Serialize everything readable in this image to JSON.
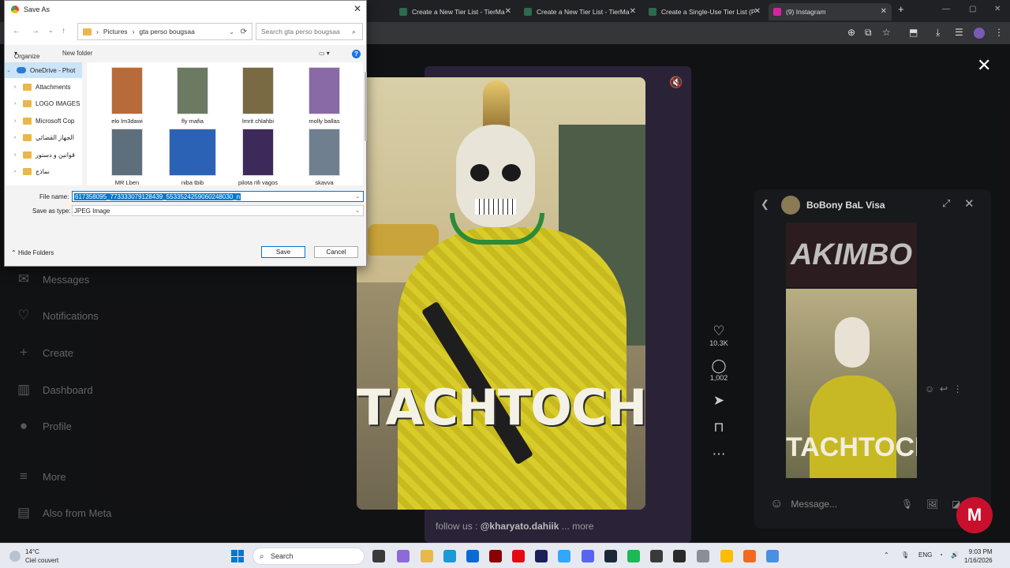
{
  "browser": {
    "tabs": [
      {
        "label": "Create a New Tier List - TierMa",
        "color": "#2d6a4f"
      },
      {
        "label": "Create a New Tier List - TierMa",
        "color": "#2d6a4f"
      },
      {
        "label": "Create a Single-Use Tier List (P",
        "color": "#2d6a4f"
      },
      {
        "label": "(9) Instagram",
        "color": "#d6249f"
      }
    ],
    "new_tab": "+"
  },
  "instagram": {
    "nav": [
      {
        "label": "Messages",
        "icon": "message-icon"
      },
      {
        "label": "Notifications",
        "icon": "heart-icon"
      },
      {
        "label": "Create",
        "icon": "plus-icon"
      },
      {
        "label": "Dashboard",
        "icon": "dashboard-icon"
      },
      {
        "label": "Profile",
        "icon": "avatar-icon"
      },
      {
        "label": "More",
        "icon": "menu-icon"
      },
      {
        "label": "Also from Meta",
        "icon": "meta-icon"
      }
    ],
    "post_title": "TACHTOCH",
    "likes": "10.3K",
    "comments": "1,002",
    "caption_prefix": "follow us :",
    "caption_handle": "@kharyato.dahiik",
    "caption_more": "... more",
    "chat": {
      "name": "BoBony BaL Visa",
      "image_top_text": "AKIMBO",
      "image_text": "TACHTOCH",
      "input_placeholder": "Message..."
    }
  },
  "dialog": {
    "title": "Save As",
    "breadcrumb": [
      "Pictures",
      "gta perso bougsaa"
    ],
    "search_placeholder": "Search gta perso bougsaa",
    "organize": "Organize",
    "new_folder": "New folder",
    "tree": [
      {
        "label": "OneDrive - Phot",
        "selected": true
      },
      {
        "label": "Attachments"
      },
      {
        "label": "LOGO IMAGES"
      },
      {
        "label": "Microsoft Cop"
      },
      {
        "label": "الجهاز القضائي"
      },
      {
        "label": "قوانين و دستور"
      },
      {
        "label": "نماذج"
      }
    ],
    "files": [
      {
        "label": "elo lm3dawi",
        "color": "#b86b3a"
      },
      {
        "label": "fly mafia",
        "color": "#6d7a62"
      },
      {
        "label": "lmrit chlahbi",
        "color": "#7a6a44"
      },
      {
        "label": "molly ballas",
        "color": "#8a6aa6"
      },
      {
        "label": "MR Lben",
        "color": "#5d6f7c"
      },
      {
        "label": "niba tbib",
        "color": "#2c62b5"
      },
      {
        "label": "pilota rifi vagos",
        "color": "#3d2a5a"
      },
      {
        "label": "skavva",
        "color": "#6f7f8f"
      }
    ],
    "file_name_label": "File name:",
    "file_name_value": "617358095_773333079128439_5533524259060248030_n",
    "save_type_label": "Save as type:",
    "save_type_value": "JPEG Image",
    "hide_folders": "Hide Folders",
    "save_button": "Save",
    "cancel_button": "Cancel"
  },
  "taskbar": {
    "temperature": "14°C",
    "weather": "Ciel couvert",
    "search": "Search",
    "lang": "ENG",
    "time": "9:03 PM",
    "date": "1/16/2026"
  }
}
